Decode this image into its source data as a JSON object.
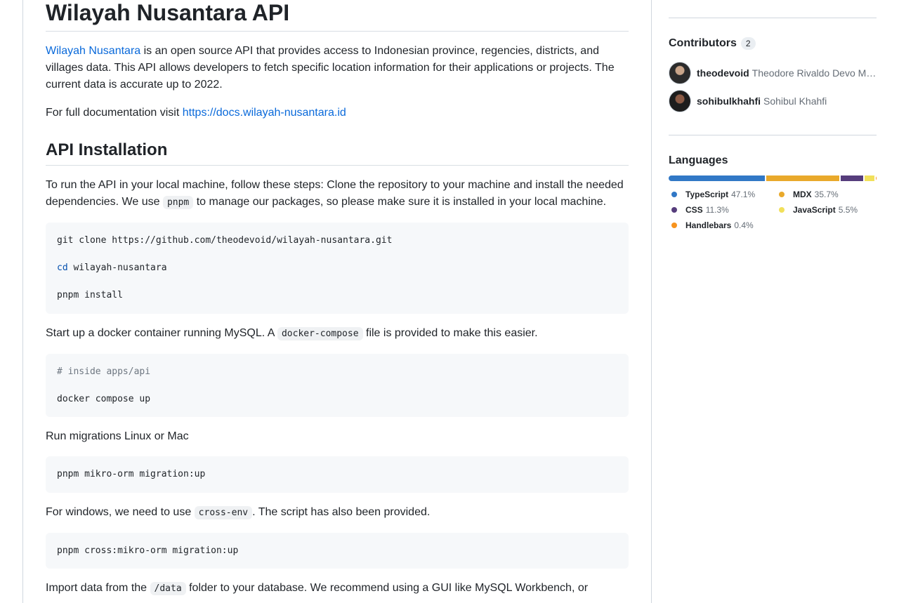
{
  "readme": {
    "title": "Wilayah Nusantara API",
    "intro_link": "Wilayah Nusantara",
    "intro_text": " is an open source API that provides access to Indonesian province, regencies, districts, and villages data. This API allows developers to fetch specific location information for their applications or projects. The current data is accurate up to 2022.",
    "docs_text": "For full documentation visit ",
    "docs_link": "https://docs.wilayah-nusantara.id",
    "install_heading": "API Installation",
    "install_p_a": "To run the API in your local machine, follow these steps: Clone the repository to your machine and install the needed dependencies. We use ",
    "install_code": "pnpm",
    "install_p_b": " to manage our packages, so please make sure it is installed in your local machine.",
    "code1": {
      "line1": "git clone https://github.com/theodevoid/wilayah-nusantara.git",
      "line2_kw": "cd",
      "line2_rest": " wilayah-nusantara",
      "line3": "pnpm install"
    },
    "docker_p_a": "Start up a docker container running MySQL. A ",
    "docker_code": "docker-compose",
    "docker_p_b": " file is provided to make this easier.",
    "code2": {
      "comment": "# inside apps/api",
      "line": "docker compose up"
    },
    "migrate_p": "Run migrations Linux or Mac",
    "code3": "pnpm mikro-orm migration:up",
    "windows_p_a": "For windows, we need to use ",
    "windows_code": "cross-env",
    "windows_p_b": ". The script has also been provided.",
    "code4": "pnpm cross:mikro-orm migration:up",
    "import_p_a": "Import data from the ",
    "import_code": "/data",
    "import_p_b": " folder to your database. We recommend using a GUI like MySQL Workbench, or"
  },
  "sidebar": {
    "contributors_title": "Contributors",
    "contributors_count": "2",
    "contributors": [
      {
        "login": "theodevoid",
        "name": "Theodore Rivaldo Devo Manurung"
      },
      {
        "login": "sohibulkhahfi",
        "name": "Sohibul Khahfi"
      }
    ],
    "languages_title": "Languages",
    "languages": [
      {
        "name": "TypeScript",
        "pct": "47.1%",
        "value": 47.1,
        "color": "#3178c6"
      },
      {
        "name": "MDX",
        "pct": "35.7%",
        "value": 35.7,
        "color": "#e9a92b"
      },
      {
        "name": "CSS",
        "pct": "11.3%",
        "value": 11.3,
        "color": "#563d7c"
      },
      {
        "name": "JavaScript",
        "pct": "5.5%",
        "value": 5.5,
        "color": "#f1e05a"
      },
      {
        "name": "Handlebars",
        "pct": "0.4%",
        "value": 0.4,
        "color": "#f7931e"
      }
    ]
  }
}
